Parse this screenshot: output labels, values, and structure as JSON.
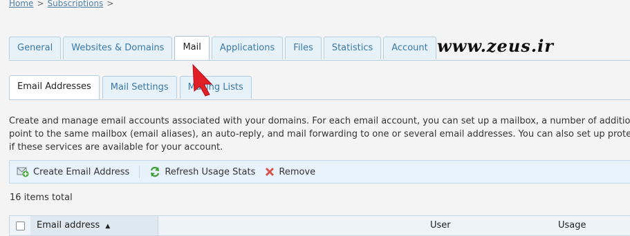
{
  "breadcrumb": {
    "items": [
      "Home",
      "Subscriptions"
    ],
    "separator": ">"
  },
  "tabs": [
    {
      "label": "General"
    },
    {
      "label": "Websites & Domains"
    },
    {
      "label": "Mail",
      "active": true
    },
    {
      "label": "Applications"
    },
    {
      "label": "Files"
    },
    {
      "label": "Statistics"
    },
    {
      "label": "Account"
    }
  ],
  "watermark": "www.zeus.ir",
  "subtabs": [
    {
      "label": "Email Addresses",
      "active": true
    },
    {
      "label": "Mail Settings"
    },
    {
      "label": "Mailing Lists"
    }
  ],
  "description": {
    "line1": "Create and manage email accounts associated with your domains. For each email account, you can set up a mailbox, a number of additio",
    "line2": "point to the same mailbox (email aliases), an auto-reply, and mail forwarding to one or several email addresses. You can also set up prote",
    "line3": "if these services are available for your account."
  },
  "toolbar": {
    "create_label": "Create Email Address",
    "refresh_label": "Refresh Usage Stats",
    "remove_label": "Remove"
  },
  "items_total": "16 items total",
  "table": {
    "columns": {
      "email": "Email address",
      "user": "User",
      "usage": "Usage"
    }
  },
  "colors": {
    "tab_background": "#e6f1f8",
    "tab_text": "#3b78a6",
    "cursor_red": "#e01f26"
  }
}
